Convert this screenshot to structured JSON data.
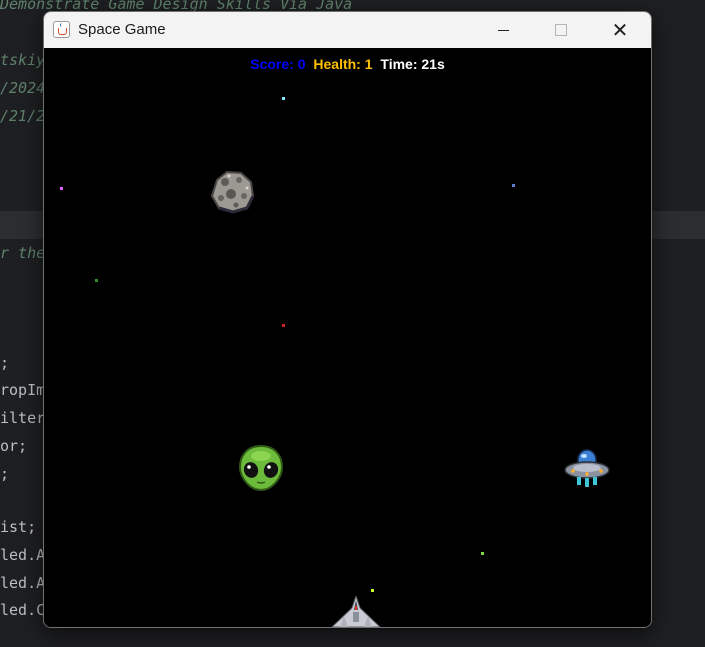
{
  "ide": {
    "lines": [
      {
        "text": "Demonstrate Game Design Skills Via Java",
        "comment": true
      },
      {
        "text": "tskiy",
        "comment": true
      },
      {
        "text": "/2024",
        "comment": true
      },
      {
        "text": "/21/2",
        "comment": true
      },
      {
        "text": "r the",
        "comment": true
      },
      {
        "text": ";",
        "comment": false
      },
      {
        "text": "ropIm",
        "comment": false
      },
      {
        "text": "ilter",
        "comment": false
      },
      {
        "text": "or;",
        "comment": false
      },
      {
        "text": ";",
        "comment": false
      },
      {
        "text": "ist;",
        "comment": false
      },
      {
        "text": "led.A",
        "comment": false
      },
      {
        "text": "led.A",
        "comment": false
      },
      {
        "text": "led.C",
        "comment": false
      }
    ]
  },
  "window": {
    "title": "Space Game",
    "controls": {
      "minimize": "minimize",
      "maximize": "maximize",
      "close": "✕"
    }
  },
  "hud": {
    "score_label": "Score: 0",
    "health_label": "Health: 1",
    "time_label": "Time: 21s",
    "colors": {
      "score": "#0000ff",
      "health": "#ffc000",
      "time": "#ffffff"
    }
  },
  "sprites": [
    "asteroid",
    "alien-head",
    "ufo",
    "player-ship"
  ],
  "star_colors": [
    "#7fe9ff",
    "#e060ff",
    "#5a7fd0",
    "#2f8f2f",
    "#d02020",
    "#7fdc3a",
    "#c8ff2a"
  ]
}
